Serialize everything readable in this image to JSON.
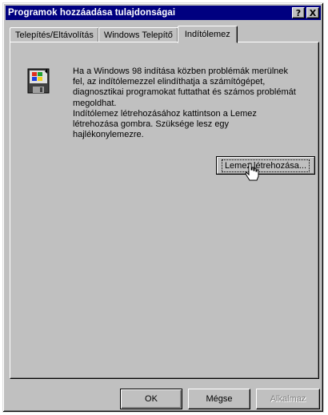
{
  "window": {
    "title": "Programok hozzáadása tulajdonságai",
    "help_glyph": "?",
    "close_glyph": "X"
  },
  "tabs": [
    {
      "label": "Telepítés/Eltávolítás"
    },
    {
      "label": "Windows Telepítő"
    },
    {
      "label": "Indítólemez",
      "active": true
    }
  ],
  "panel": {
    "icon": "startup-disk-icon",
    "description_lines": [
      "Ha a Windows 98 indítása közben problémák merülnek",
      "fel, az indítólemezzel elindíthatja a számítógépet,",
      "diagnosztikai programokat futtathat és számos problémát",
      "megoldhat.",
      "Indítólemez létrehozásához kattintson a Lemez",
      "létrehozása gombra. Szüksége lesz egy",
      "hajlékonylemezre."
    ],
    "create_button_label": "Lemez létrehozása..."
  },
  "footer": {
    "ok_label": "OK",
    "cancel_label": "Mégse",
    "apply_label": "Alkalmaz",
    "apply_enabled": false
  },
  "colors": {
    "titlebar": "#000080",
    "face": "#c0c0c0",
    "disabled_text": "#808080"
  }
}
